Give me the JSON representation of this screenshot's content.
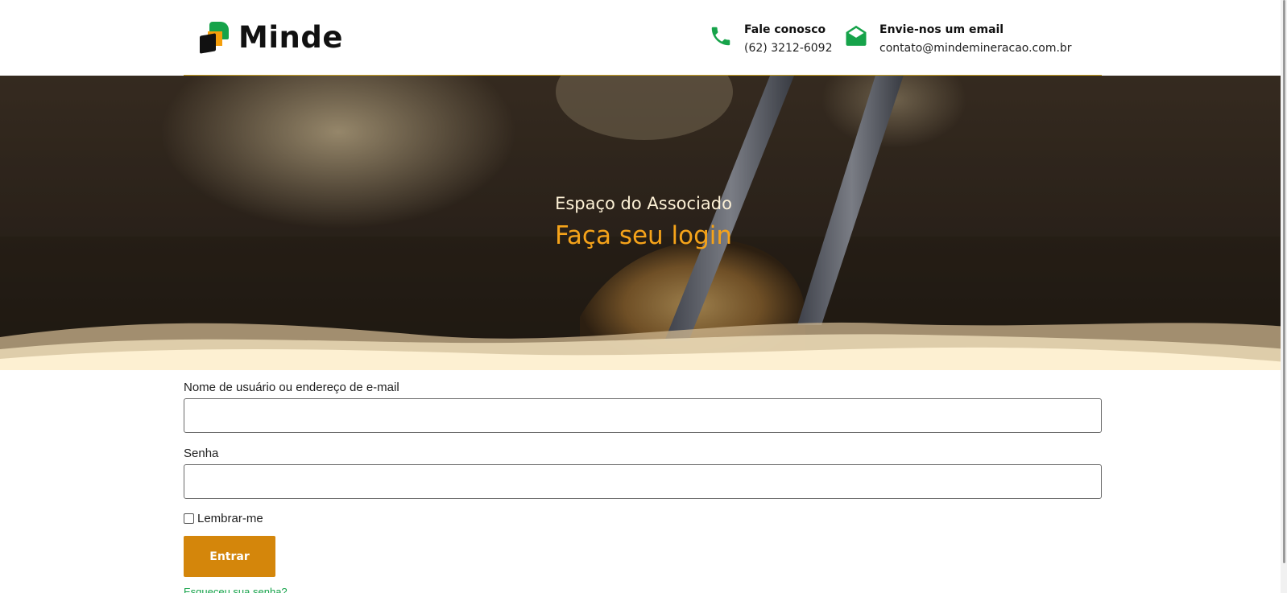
{
  "header": {
    "logo_text": "Minde",
    "phone": {
      "title": "Fale conosco",
      "value": "(62) 3212-6092"
    },
    "email": {
      "title": "Envie-nos um email",
      "value": "contato@mindemineracao.com.br"
    }
  },
  "hero": {
    "subtitle": "Espaço do Associado",
    "title": "Faça seu login"
  },
  "form": {
    "username_label": "Nome de usuário ou endereço de e-mail",
    "username_value": "",
    "password_label": "Senha",
    "password_value": "",
    "remember_label": "Lembrar-me",
    "remember_checked": false,
    "submit_label": "Entrar",
    "forgot_label": "Esqueceu sua senha?"
  },
  "colors": {
    "accent_green": "#16a34a",
    "accent_orange": "#d4860b",
    "hero_title": "#f5a31a",
    "hero_subtitle": "#fdf1d6",
    "wave": "#fdf0d2"
  },
  "icons": {
    "phone": "phone-icon",
    "email": "envelope-icon"
  }
}
